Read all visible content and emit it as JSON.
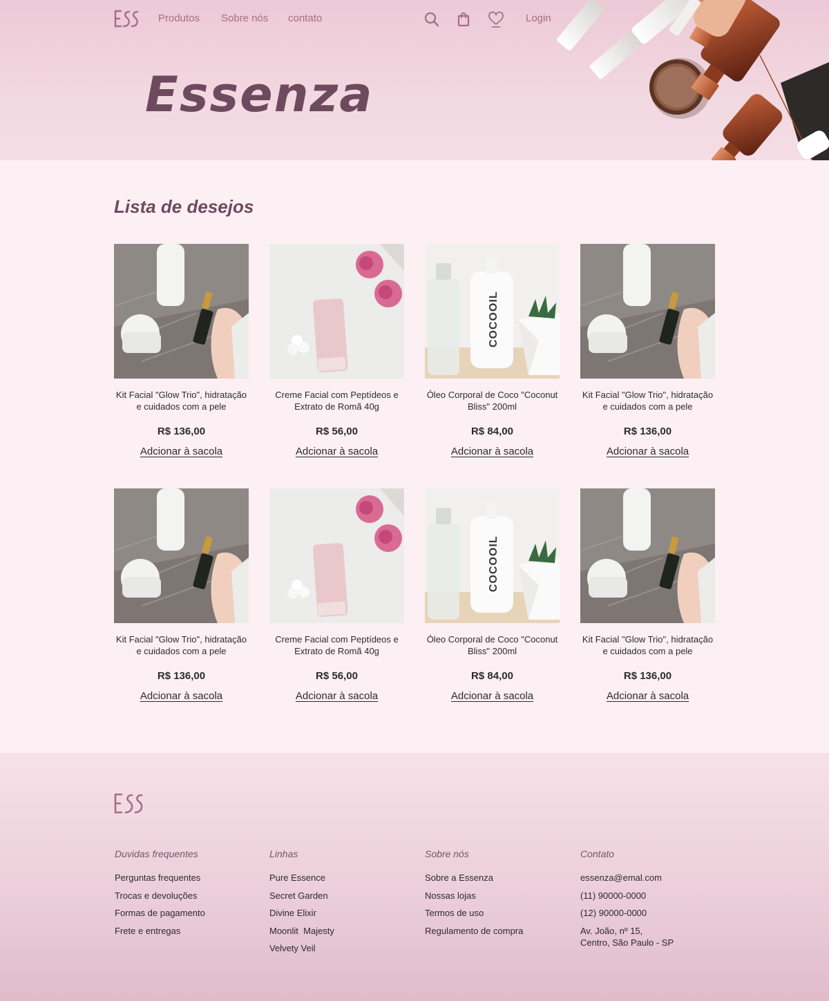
{
  "nav": {
    "links": [
      "Produtos",
      "Sobre nós",
      "contato"
    ],
    "login": "Login",
    "icons": [
      "search-icon",
      "bag-icon",
      "heart-icon"
    ]
  },
  "hero": {
    "brand": "Essenza"
  },
  "wishlist": {
    "title": "Lista de desejos",
    "add_label": "Adcionar à sacola",
    "products": [
      {
        "name": "Kit Facial \"Glow Trio\", hidratação e cuidados com a pele",
        "price": "R$ 136,00",
        "image": "kit"
      },
      {
        "name": "Creme Facial com Peptídeos e Extrato de Romã 40g",
        "price": "R$ 56,00",
        "image": "creme"
      },
      {
        "name": "Óleo Corporal de Coco \"Coconut Bliss\" 200ml",
        "price": "R$ 84,00",
        "image": "oleo"
      },
      {
        "name": "Kit Facial \"Glow Trio\", hidratação e cuidados com a pele",
        "price": "R$ 136,00",
        "image": "kit"
      },
      {
        "name": "Kit Facial \"Glow Trio\", hidratação e cuidados com a pele",
        "price": "R$ 136,00",
        "image": "kit"
      },
      {
        "name": "Creme Facial com Peptídeos e Extrato de Romã 40g",
        "price": "R$ 56,00",
        "image": "creme"
      },
      {
        "name": "Óleo Corporal de Coco \"Coconut Bliss\" 200ml",
        "price": "R$ 84,00",
        "image": "oleo"
      },
      {
        "name": "Kit Facial \"Glow Trio\", hidratação e cuidados com a pele",
        "price": "R$ 136,00",
        "image": "kit"
      }
    ]
  },
  "footer": {
    "columns": [
      {
        "title": "Duvidas frequentes",
        "items": [
          "Perguntas frequentes",
          "Trocas e devoluções",
          "Formas de pagamento",
          "Frete e entregas"
        ]
      },
      {
        "title": "Linhas",
        "items": [
          "Pure Essence",
          "Secret Garden",
          "Divine Elixir",
          "Moonlit  Majesty",
          "Velvety Veil"
        ]
      },
      {
        "title": "Sobre nós",
        "items": [
          "Sobre a Essenza",
          "Nossas lojas",
          "Termos de uso",
          "Regulamento de compra"
        ]
      },
      {
        "title": "Contato",
        "items": [
          "essenza@emal.com",
          "(11) 90000-0000",
          "(12) 90000-0000",
          "Av. João, nº 15,\nCentro, São Paulo - SP"
        ]
      }
    ]
  },
  "colors": {
    "accent": "#a36e86",
    "brand": "#6e4a5e",
    "background": "#fdf0f4"
  }
}
